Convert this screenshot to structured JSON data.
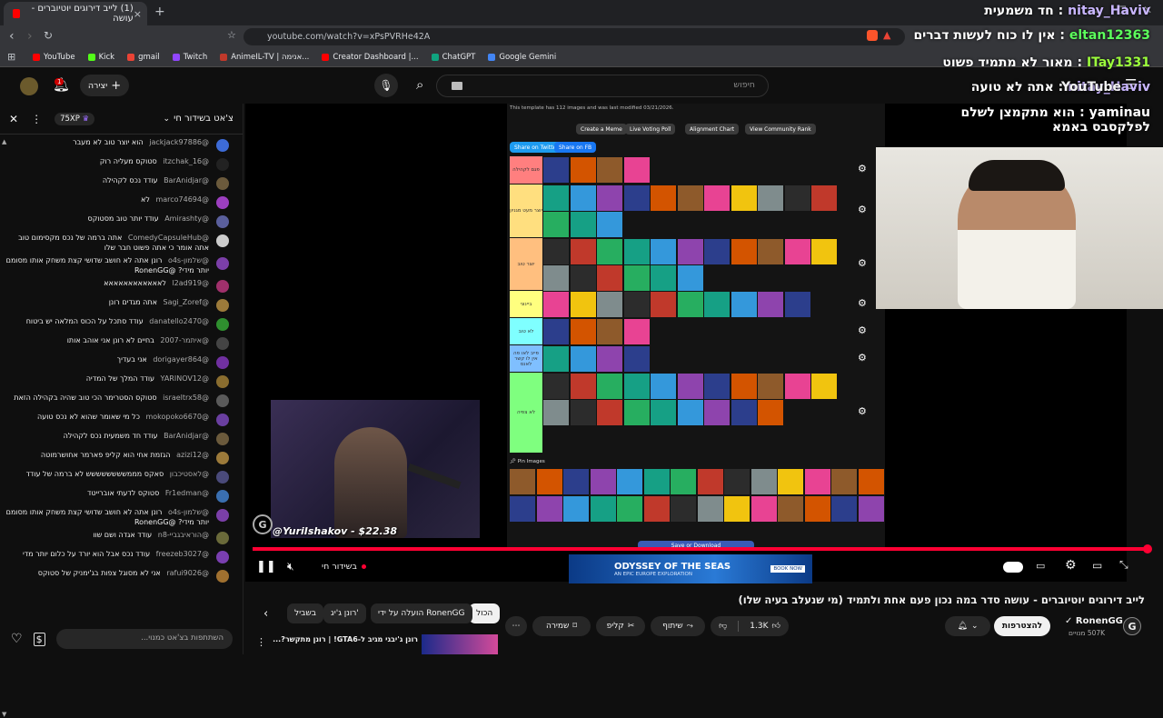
{
  "browser": {
    "tab_title": "(1) לייב דירוגים יוטיוברים - עושה",
    "tab_close": "×",
    "new_tab": "+",
    "url": "youtube.com/watch?v=xPsPVRHe42A",
    "bookmarks": [
      {
        "label": "YouTube",
        "color": "#ff0000"
      },
      {
        "label": "Kick",
        "color": "#53fc18"
      },
      {
        "label": "gmail",
        "color": "#ea4335"
      },
      {
        "label": "Twitch",
        "color": "#9146ff"
      },
      {
        "label": "AnimeIL-TV | אנימה...",
        "color": "#c0392b"
      },
      {
        "label": "Creator Dashboard |...",
        "color": "#ff0000"
      },
      {
        "label": "ChatGPT",
        "color": "#10a37f"
      },
      {
        "label": "Google Gemini",
        "color": "#4285f4"
      }
    ]
  },
  "youtube": {
    "search_placeholder": "חיפוש",
    "create_label": "יצירה",
    "notification_count": "1",
    "logo_text": "YouTube"
  },
  "chat": {
    "header_title": "צ'אט בשידור חי",
    "xp_badge": "75XP",
    "messages": [
      {
        "name": "@jackjack97886",
        "text": "הוא יוצר טוב לא מעבר",
        "color": "#3d6bd6"
      },
      {
        "name": "@itzchak_16",
        "text": "סטוקס מעליה רוק",
        "color": "#222"
      },
      {
        "name": "@BarAnidjar",
        "text": "עודד נכס לקהילה",
        "color": "#6b5a3c"
      },
      {
        "name": "@marco74694",
        "text": "לא",
        "color": "#9c3fbf"
      },
      {
        "name": "@Amirashty",
        "text": "עודד יותר טוב מסטוקס",
        "color": "#5a5f9c"
      },
      {
        "name": "@ComedyCapsuleHub",
        "text": "אתה ברמה של נכס מקסימום טוב אתה אומר כי אתה פשוט חבר שלו",
        "color": "#ccc"
      },
      {
        "name": "@שלמון-o4s",
        "text": "רונן אתה לא חושב שדושי קצת משחק אותו מסומם יותר מידי? @RonenGG",
        "color": "#7b3fa8"
      },
      {
        "name": "@l2ad919",
        "text": "לאאאאאאאאאאאא",
        "color": "#a0306b"
      },
      {
        "name": "@Sagi_Zoref",
        "text": "אתה מגדים רונן",
        "color": "#9c7a3a"
      },
      {
        "name": "@danatello2470",
        "text": "עודד סתכל על הכוס המלאה יש ביטוח",
        "color": "#2f8f2f"
      },
      {
        "name": "@איתמר-2007",
        "text": "בחיים לא רונן אני אוהב אותו",
        "color": "#444"
      },
      {
        "name": "@dorigayer864",
        "text": "אני בעדיך",
        "color": "#7030a0"
      },
      {
        "name": "@YARINOV12",
        "text": "עודד המלך של המדיה",
        "color": "#8a6d2f"
      },
      {
        "name": "@israeltrx58",
        "text": "סטוקס הסטרימר הכי טוב שהיה בקהילה הזאת",
        "color": "#5a5a5a"
      },
      {
        "name": "@mokopoko6670",
        "text": "כל מי שאומר שהוא לא נכס טועה",
        "color": "#6a3fa0"
      },
      {
        "name": "@BarAnidjar",
        "text": "עודד חד משמעית נכס לקהילה",
        "color": "#6b5a3c"
      },
      {
        "name": "@azizi12",
        "text": "הגזמת אחי הוא קליפ פארמר אחושרמוטה",
        "color": "#9c7a3a"
      },
      {
        "name": "@לאסטיכבון",
        "text": "סאקס מממשששששששש לא ברמה של עודד",
        "color": "#4a4a7a"
      },
      {
        "name": "@Fr1edman",
        "text": "סטוקס לדעתי אוברייטד",
        "color": "#3a6fb0"
      },
      {
        "name": "@שלמון-o4s",
        "text": "רונן אתה לא חושב שדושי קצת משחק אותו מסומם יותר מידי? @RonenGG",
        "color": "#7b3fa8"
      },
      {
        "name": "@הוראיבגביי-n8",
        "text": "עודד אגדה ושם שוו",
        "color": "#6a6a3a"
      },
      {
        "name": "@freezeb3027",
        "text": "עודד נכס אבל הוא יורד על כלום יותר מדי",
        "color": "#7a3fb0"
      },
      {
        "name": "@rafui9026",
        "text": "אני לא מסוגל צפות בג'ימניק של סטוקס",
        "color": "#a0702f"
      }
    ],
    "input_placeholder": "השתתפות בצ'אט כמנוי..."
  },
  "tierlist": {
    "template_note": "This template has 112 images and was last modified 03/21/2026.",
    "buttons": [
      "Create a Meme",
      "Live Voting Poll",
      "Alignment Chart",
      "View Community Rank"
    ],
    "share_buttons": [
      "Share on Twitter",
      "Share on FB"
    ],
    "tiers": [
      {
        "label": "פגם לקהילה",
        "color": "#ff7f7f"
      },
      {
        "label": "יוצר מעט מגניון",
        "color": "#ffdf7f"
      },
      {
        "label": "יוצר טוב",
        "color": "#ffbf7f"
      },
      {
        "label": "ביינוני",
        "color": "#ffff7f"
      },
      {
        "label": "לא טוב",
        "color": "#7fffff"
      },
      {
        "label": "פייב לאו פה אין לו קשר לאנס",
        "color": "#7fbfff"
      },
      {
        "label": "לא צפיה",
        "color": "#7fff7f"
      }
    ],
    "pin_images_label": "Pin Images",
    "save_button": "Save or Download"
  },
  "overlay": {
    "donation": "@YuriIshakov - $22.38",
    "chat_lines": [
      {
        "name": "nitay_Haviv",
        "text": "חד משמעית",
        "color": "#c9b6ff"
      },
      {
        "name": "eltan12363",
        "text": "אין לו כוח לעשות דברים",
        "color": "#5cff5c"
      },
      {
        "name": "ITay1331",
        "text": "מאור לא מתמיד פשוט",
        "color": "#9cff3c"
      },
      {
        "name": "nitay_Haviv",
        "text": "אתה לא טועה",
        "color": "#c9b6ff"
      },
      {
        "name": "yaminau",
        "text": "הוא מתקמצן לשלם לפלקסבס באמא",
        "color": "#ffffff"
      }
    ]
  },
  "player": {
    "live_label": "בשידור חי",
    "ad_title": "ODYSSEY OF THE SEAS",
    "ad_subtitle": "AN EPIC EUROPE EXPLORATION",
    "ad_cta": "BOOK NOW"
  },
  "video": {
    "title": "לייב דירוגים יוטיוברים - עושה סדר במה נכון פעם אחת ולתמיד (מי שנעלב בעיה שלו)",
    "channel": "RonenGG",
    "subscribers": "507K מנויים",
    "subscribe_label": "להצטרפות",
    "likes": "1.3K",
    "share_label": "שיתוף",
    "clip_label": "קליפ",
    "save_label": "שמירה",
    "more_label": "⋯"
  },
  "related_chips": [
    "הכול",
    "הועלה על ידי RonenGG",
    "רונן ג'יג'",
    "בשביל"
  ],
  "related_video_title": "רונן ג'יבגי מגיב ל-GTA6! | רונן מתקשר?..."
}
